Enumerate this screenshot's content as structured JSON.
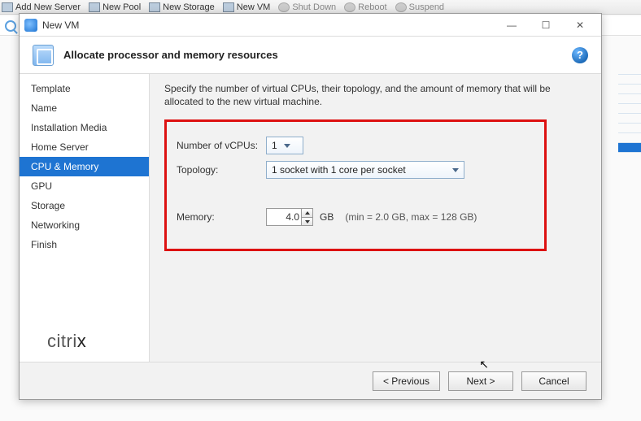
{
  "background": {
    "toolbar": [
      {
        "label": "Add New Server"
      },
      {
        "label": "New Pool"
      },
      {
        "label": "New Storage"
      },
      {
        "label": "New VM"
      },
      {
        "label": "Shut Down"
      },
      {
        "label": "Reboot"
      },
      {
        "label": "Suspend"
      }
    ]
  },
  "dialog": {
    "title": "New VM",
    "header": "Allocate processor and memory resources",
    "help_glyph": "?",
    "brand": "citrix",
    "steps": [
      {
        "label": "Template"
      },
      {
        "label": "Name"
      },
      {
        "label": "Installation Media"
      },
      {
        "label": "Home Server"
      },
      {
        "label": "CPU & Memory",
        "active": true
      },
      {
        "label": "GPU"
      },
      {
        "label": "Storage"
      },
      {
        "label": "Networking"
      },
      {
        "label": "Finish"
      }
    ],
    "content": {
      "description": "Specify the number of virtual CPUs, their topology, and the amount of memory that will be allocated to the new virtual machine.",
      "vcpus": {
        "label": "Number of vCPUs:",
        "value": "1"
      },
      "topology": {
        "label": "Topology:",
        "value": "1 socket with 1 core per socket"
      },
      "memory": {
        "label": "Memory:",
        "value": "4.0",
        "unit": "GB",
        "hint": "(min = 2.0 GB, max = 128 GB)"
      }
    },
    "buttons": {
      "prev": "< Previous",
      "next": "Next >",
      "cancel": "Cancel"
    },
    "win": {
      "min": "—",
      "max": "☐",
      "close": "✕"
    }
  }
}
